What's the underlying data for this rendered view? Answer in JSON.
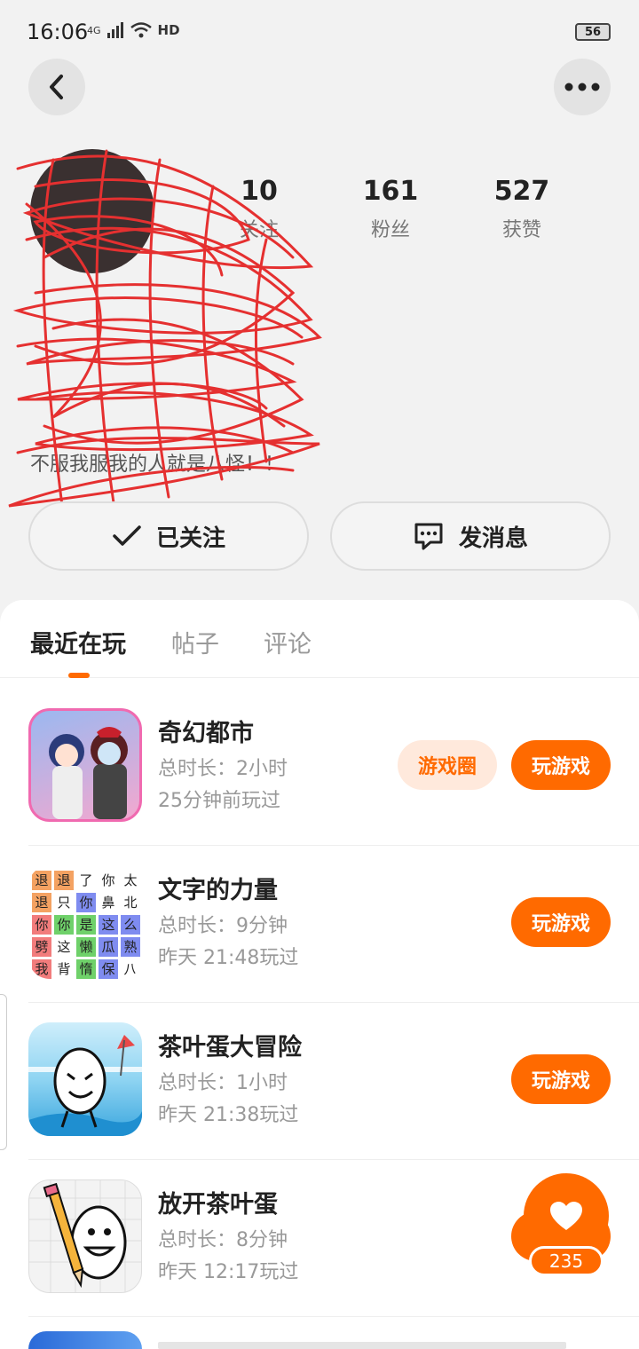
{
  "status_bar": {
    "time": "16:06",
    "network": "4G",
    "hd": "HD",
    "battery": "56"
  },
  "profile": {
    "stats": [
      {
        "value": "10",
        "label": "关注"
      },
      {
        "value": "161",
        "label": "粉丝"
      },
      {
        "value": "527",
        "label": "获赞"
      }
    ],
    "bio_last_line": "不服我服我的人就是八怪！！"
  },
  "actions": {
    "follow_label": "已关注",
    "message_label": "发消息"
  },
  "tabs": [
    {
      "label": "最近在玩",
      "active": true
    },
    {
      "label": "帖子",
      "active": false
    },
    {
      "label": "评论",
      "active": false
    }
  ],
  "games": [
    {
      "title": "奇幻都市",
      "duration": "总时长：2小时",
      "last_played": "25分钟前玩过",
      "circle_label": "游戏圈",
      "play_label": "玩游戏"
    },
    {
      "title": "文字的力量",
      "duration": "总时长：9分钟",
      "last_played": "昨天 21:48玩过",
      "play_label": "玩游戏",
      "icon_chars": [
        "退",
        "退",
        "了",
        "你",
        "太",
        "退",
        "只",
        "你",
        "鼻",
        "北",
        "你",
        "你",
        "是",
        "这",
        "么",
        "劈",
        "这",
        "懒",
        "瓜",
        "熟",
        "我",
        "背",
        "惰",
        "保",
        "八"
      ]
    },
    {
      "title": "茶叶蛋大冒险",
      "duration": "总时长：1小时",
      "last_played": "昨天 21:38玩过",
      "play_label": "玩游戏"
    },
    {
      "title": "放开茶叶蛋",
      "duration": "总时长：8分钟",
      "last_played": "昨天 12:17玩过"
    }
  ],
  "like_float": {
    "count": "235"
  },
  "colors": {
    "accent": "#ff6a00",
    "accent_light": "#ffe9dc",
    "scribble": "#e53030"
  }
}
